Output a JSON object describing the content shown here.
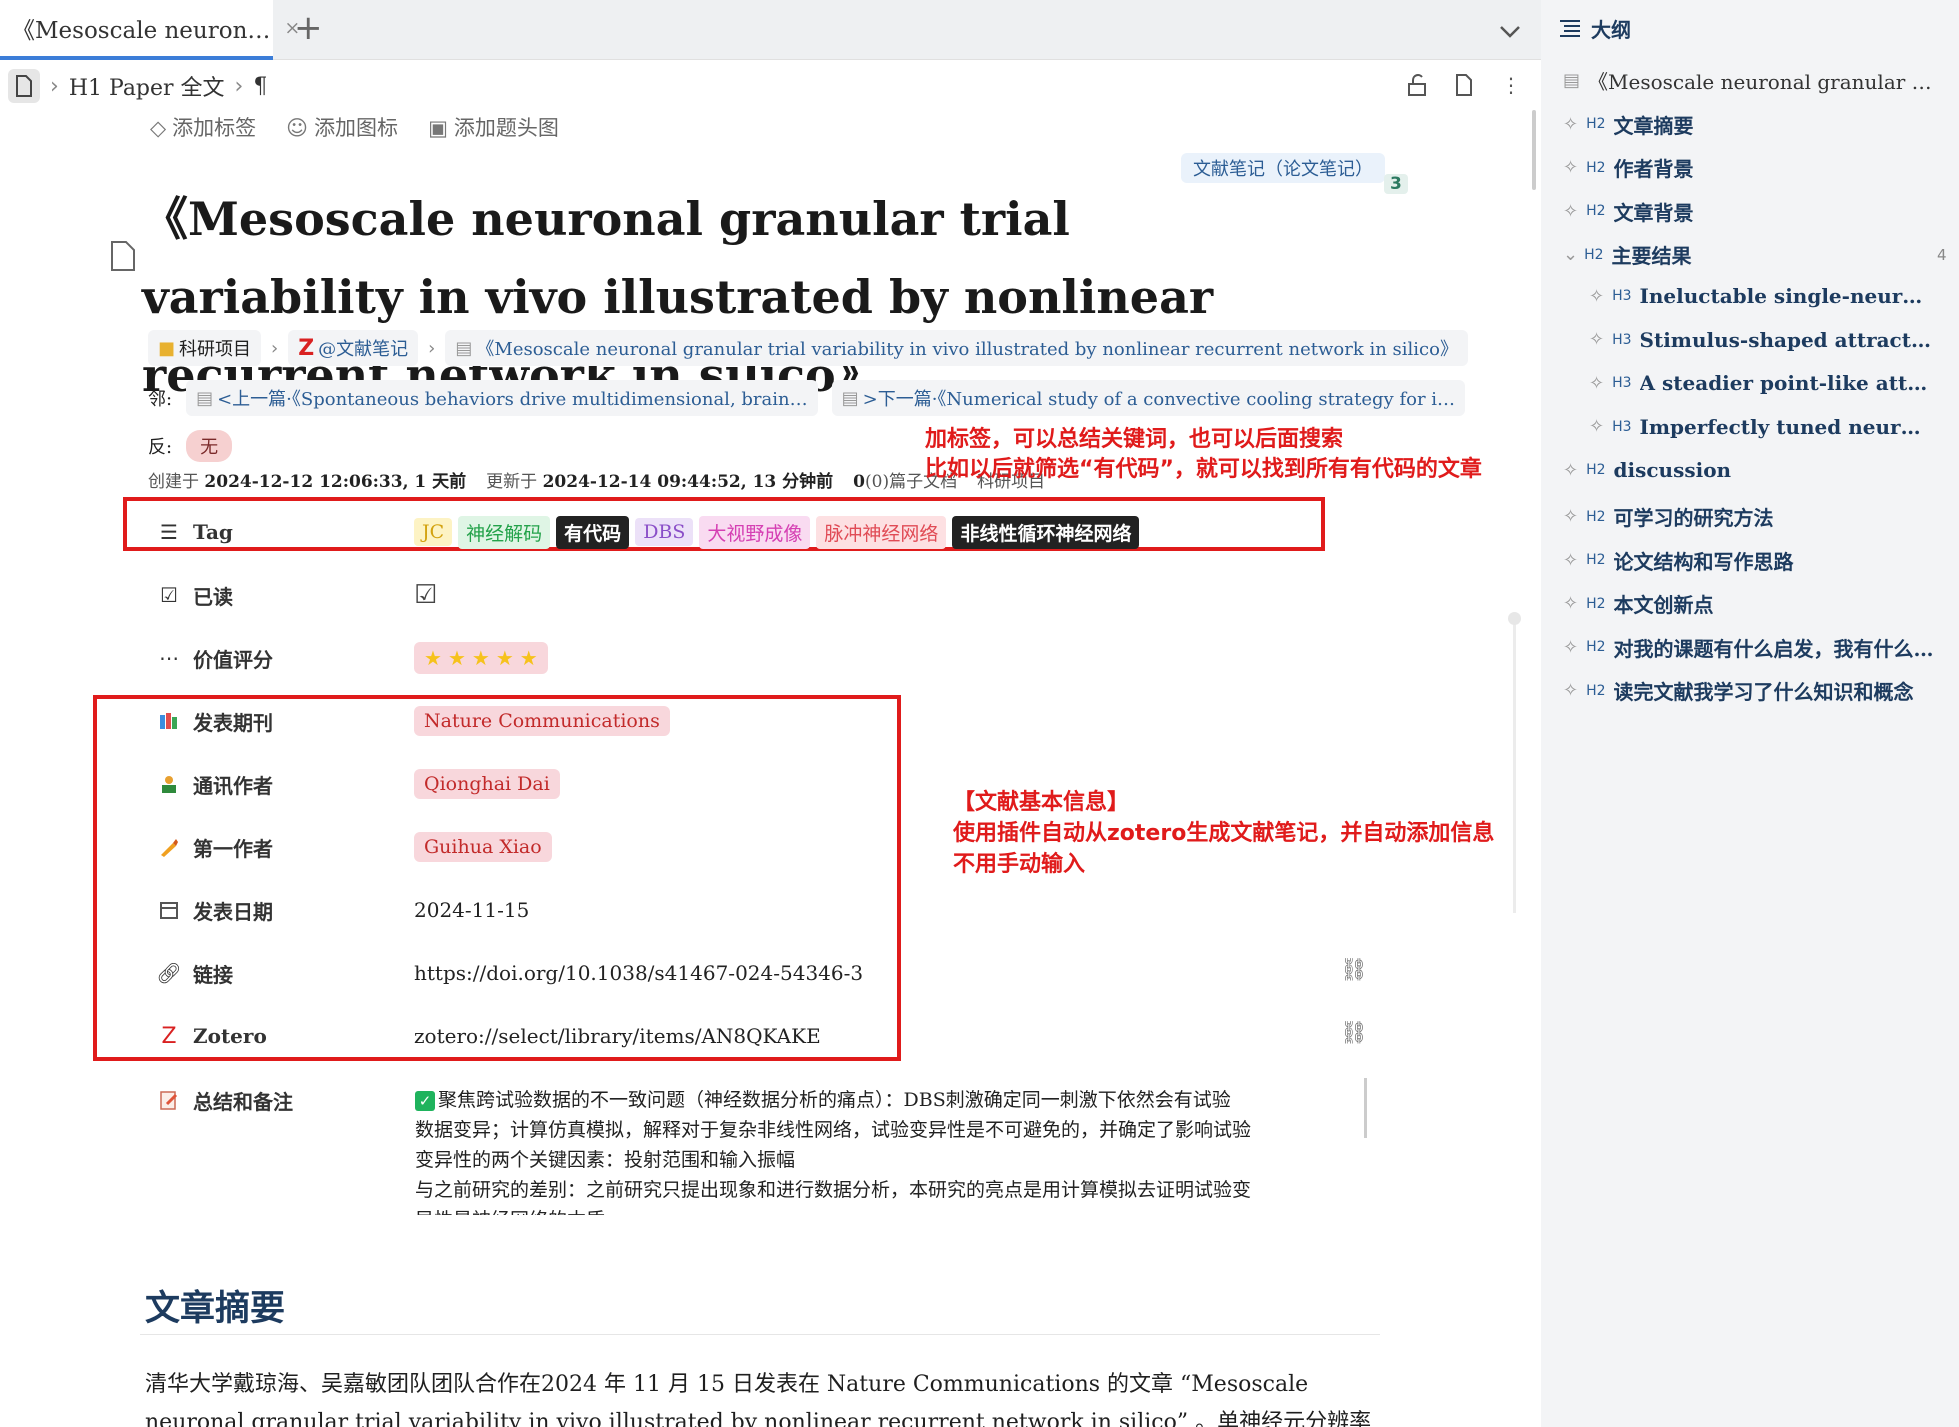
{
  "tab": {
    "title": "《Mesoscale neuron…",
    "close": "×",
    "add": "+"
  },
  "breadcrumb": {
    "heading_mark": "H1",
    "doc": "Paper 全文",
    "para": "¶"
  },
  "add_actions": [
    {
      "icon": "◇",
      "label": "添加标签"
    },
    {
      "icon": "☺",
      "label": "添加图标"
    },
    {
      "icon": "▣",
      "label": "添加题头图"
    }
  ],
  "ref_note": {
    "label": "文献笔记（论文笔记）",
    "count": "3"
  },
  "title": "《Mesoscale neuronal granular trial variability in vivo illustrated by nonlinear recurrent network in silico》",
  "path": {
    "folder": "科研项目",
    "z": "Z",
    "zlabel": "@文献笔记",
    "doc": "《Mesoscale neuronal granular trial variability in vivo illustrated by nonlinear recurrent network in silico》"
  },
  "neighbors": {
    "label": "邻:",
    "prev": "<上一篇·《Spontaneous behaviors drive multidimensional, brain…",
    "next": ">下一篇·《Numerical study of a convective cooling strategy for i…"
  },
  "backlinks": {
    "label": "反:",
    "value": "无"
  },
  "meta": {
    "created_label": "创建于",
    "created": "2024-12-12 12:06:33, 1 天前",
    "updated_label": "更新于",
    "updated": "2024-12-14 09:44:52, 13 分钟前",
    "subdocs_count": "0",
    "subdocs": "(0)篇子文档",
    "project": "科研项目"
  },
  "annotations": {
    "tag_note_1": "加标签，可以总结关键词，也可以后面搜索",
    "tag_note_2": "比如以后就筛选“有代码”，就可以找到所有有代码的文章",
    "info_note_1": "【文献基本信息】",
    "info_note_2": "使用插件自动从zotero生成文献笔记，并自动添加信息",
    "info_note_3": "不用手动输入"
  },
  "props": {
    "tag": {
      "label": "Tag",
      "values": [
        {
          "text": "JC",
          "bg": "#fdf3c4",
          "fg": "#d3a20f"
        },
        {
          "text": "神经解码",
          "bg": "#dff5e5",
          "fg": "#23a24a"
        },
        {
          "text": "有代码",
          "bg": "#222222",
          "fg": "#ffffff"
        },
        {
          "text": "DBS",
          "bg": "#ece1f8",
          "fg": "#8a4fc8"
        },
        {
          "text": "大视野成像",
          "bg": "#f9dbf1",
          "fg": "#d53fb3"
        },
        {
          "text": "脉冲神经网络",
          "bg": "#fde0e2",
          "fg": "#e04b55"
        },
        {
          "text": "非线性循环神经网络",
          "bg": "#222222",
          "fg": "#ffffff"
        }
      ]
    },
    "read": {
      "label": "已读",
      "checked_symbol": "☑"
    },
    "rating": {
      "label": "价值评分",
      "stars": 5
    },
    "journal": {
      "label": "发表期刊",
      "value": "Nature Communications"
    },
    "corresponding": {
      "label": "通讯作者",
      "value": "Qionghai Dai"
    },
    "first_author": {
      "label": "第一作者",
      "value": "Guihua Xiao"
    },
    "date": {
      "label": "发表日期",
      "value": "2024-11-15"
    },
    "link": {
      "label": "链接",
      "value": "https://doi.org/10.1038/s41467-024-54346-3"
    },
    "zotero": {
      "label": "Zotero",
      "z": "Z",
      "value": "zotero://select/library/items/AN8QKAKE"
    },
    "summary": {
      "label": "总结和备注"
    }
  },
  "summary_lines": [
    "聚焦跨试验数据的不一致问题（神经数据分析的痛点）：DBS刺激确定同一刺激下依然会有试验",
    "数据变异；计算仿真模拟，解释对于复杂非线性网络，试验变异性是不可避免的，并确定了影响试验",
    "变异性的两个关键因素：投射范围和输入振幅",
    "与之前研究的差别：之前研究只提出现象和进行数据分析，本研究的亮点是用计算模拟去证明试验变",
    "异性是神经网络的本质"
  ],
  "section": {
    "heading": "文章摘要",
    "para": "清华大学戴琼海、吴嘉敏团队团队合作在2024 年 11 月 15 日发表在 Nature Communications 的文章 “Mesoscale neuronal granular trial variability in vivo illustrated by nonlinear recurrent network in silico” 。单神经元分辨率的"
  },
  "outline": {
    "title": "大纲",
    "items": [
      {
        "level": "doc",
        "text": "《Mesoscale neuronal granular trial v…"
      },
      {
        "level": "H2",
        "text": "文章摘要"
      },
      {
        "level": "H2",
        "text": "作者背景"
      },
      {
        "level": "H2",
        "text": "文章背景"
      },
      {
        "level": "H2",
        "text": "主要结果",
        "count": "4",
        "expanded": true
      },
      {
        "level": "H3",
        "text": "Ineluctable single-neuron and p…"
      },
      {
        "level": "H3",
        "text": "Stimulus-shaped attractor mode…"
      },
      {
        "level": "H3",
        "text": "A steadier point-like attractor re…"
      },
      {
        "level": "H3",
        "text": "Imperfectly tuned neurons cons…"
      },
      {
        "level": "H2",
        "text": "discussion"
      },
      {
        "level": "H2",
        "text": "可学习的研究方法"
      },
      {
        "level": "H2",
        "text": "论文结构和写作思路"
      },
      {
        "level": "H2",
        "text": "本文创新点"
      },
      {
        "level": "H2",
        "text": "对我的课题有什么启发，我有什么…"
      },
      {
        "level": "H2",
        "text": "读完文献我学习了什么知识和概念"
      }
    ]
  }
}
